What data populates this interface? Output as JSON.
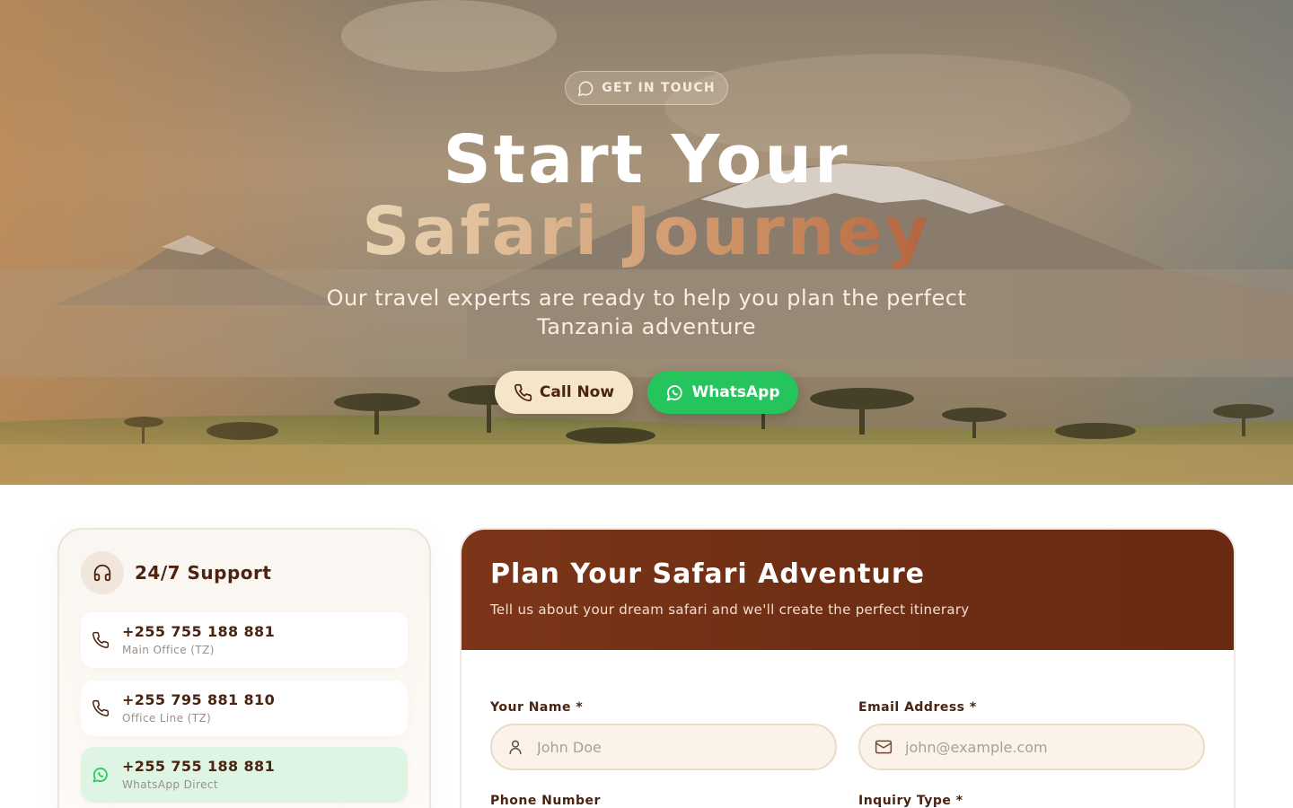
{
  "hero": {
    "badge": "GET IN TOUCH",
    "title_line1": "Start Your",
    "title_line2": "Safari Journey",
    "subtitle": "Our travel experts are ready to help you plan the perfect Tanzania adventure",
    "call_button": "Call Now",
    "whatsapp_button": "WhatsApp"
  },
  "support": {
    "title": "24/7 Support",
    "contacts": [
      {
        "number": "+255 755 188 881",
        "label": "Main Office (TZ)",
        "icon": "phone-icon"
      },
      {
        "number": "+255 795 881 810",
        "label": "Office Line (TZ)",
        "icon": "phone-icon"
      },
      {
        "number": "+255 755 188 881",
        "label": "WhatsApp Direct",
        "icon": "whatsapp-icon"
      }
    ]
  },
  "form": {
    "title": "Plan Your Safari Adventure",
    "subtitle": "Tell us about your dream safari and we'll create the perfect itinerary",
    "name_label": "Your Name *",
    "name_placeholder": "John Doe",
    "email_label": "Email Address *",
    "email_placeholder": "john@example.com",
    "phone_label": "Phone Number",
    "inquiry_label": "Inquiry Type *"
  },
  "colors": {
    "brand_brown": "#6e2e14",
    "cream": "#f6e5c6",
    "whatsapp_green": "#25c45c"
  }
}
